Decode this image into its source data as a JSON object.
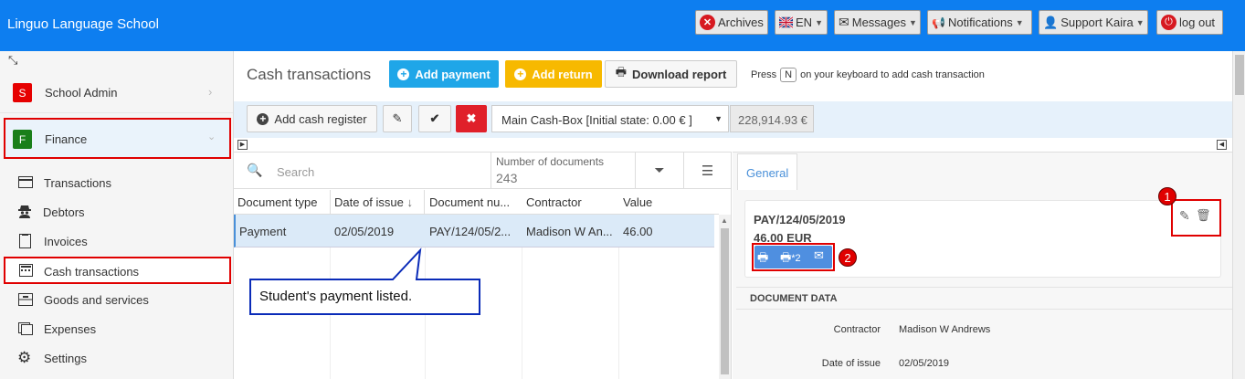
{
  "app": {
    "title": "Linguo Language School"
  },
  "topbar": {
    "archives": "Archives",
    "language": "EN",
    "messages": "Messages",
    "notifications": "Notifications",
    "user": "Support Kaira",
    "logout": "log out"
  },
  "sidebar": {
    "modules": [
      {
        "badge": "S",
        "label": "School Admin",
        "color": "#e60000"
      },
      {
        "badge": "F",
        "label": "Finance",
        "color": "#1a7f1a"
      }
    ],
    "items": [
      {
        "label": "Transactions",
        "icon": "card-icon"
      },
      {
        "label": "Debtors",
        "icon": "detective-icon"
      },
      {
        "label": "Invoices",
        "icon": "document-icon"
      },
      {
        "label": "Cash transactions",
        "icon": "cash-register-icon"
      },
      {
        "label": "Goods and services",
        "icon": "boxes-icon"
      },
      {
        "label": "Expenses",
        "icon": "expenses-icon"
      },
      {
        "label": "Settings",
        "icon": "gear-icon"
      }
    ]
  },
  "header": {
    "title": "Cash transactions",
    "add_payment": "Add payment",
    "add_return": "Add return",
    "download_report": "Download report",
    "hint_prefix": "Press",
    "hint_key": "N",
    "hint_suffix": "on your keyboard to add cash transaction"
  },
  "cashbox": {
    "add_register": "Add cash register",
    "selected": "Main Cash-Box [Initial state: 0.00 € ]",
    "balance": "228,914.93 €"
  },
  "list": {
    "search_placeholder": "Search",
    "count_label": "Number of documents",
    "count_value": "243",
    "columns": [
      "Document type",
      "Date of issue",
      "Document nu...",
      "Contractor",
      "Value"
    ],
    "rows": [
      [
        "Payment",
        "02/05/2019",
        "PAY/124/05/2...",
        "Madison W An...",
        "46.00"
      ]
    ]
  },
  "callout": {
    "text": "Student's payment listed."
  },
  "detail": {
    "tab": "General",
    "doc_number": "PAY/124/05/2019",
    "amount": "46.00 EUR",
    "print_x2": "*2",
    "section_title": "DOCUMENT DATA",
    "fields": [
      {
        "label": "Contractor",
        "value": "Madison W Andrews"
      },
      {
        "label": "Date of issue",
        "value": "02/05/2019"
      }
    ],
    "markers": [
      "1",
      "2"
    ]
  },
  "colors": {
    "topbar": "#0d7ef0",
    "primary": "#2ea6ef",
    "warning": "#f7b900",
    "danger": "#e0202a",
    "annotation": "#e00000",
    "callout_border": "#0a2bb8"
  }
}
